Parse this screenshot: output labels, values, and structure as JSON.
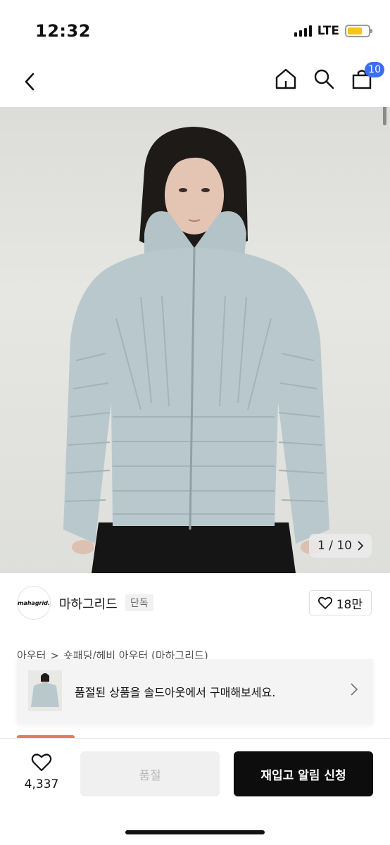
{
  "status": {
    "time": "12:32",
    "network": "LTE"
  },
  "nav": {
    "cart_count": "10"
  },
  "hero": {
    "counter": "1 / 10"
  },
  "brand": {
    "logo_text": "mahagrid.",
    "name": "마하그리드",
    "tag": "단독",
    "likes": "18만"
  },
  "breadcrumb": {
    "items": [
      "아우터",
      "숏패딩/헤비 아우터 (마하그리드)"
    ]
  },
  "banner": {
    "text": "품절된 상품을 솔드아웃에서 구매해보세요."
  },
  "actions": {
    "wish_count": "4,337",
    "soldout_label": "품절",
    "restock_label": "재입고 알림 신청"
  },
  "colors": {
    "accent": "#3b6ff0",
    "battery": "#f5c518",
    "primary_button": "#0d0d0d",
    "jacket": "#b9c8cd"
  }
}
